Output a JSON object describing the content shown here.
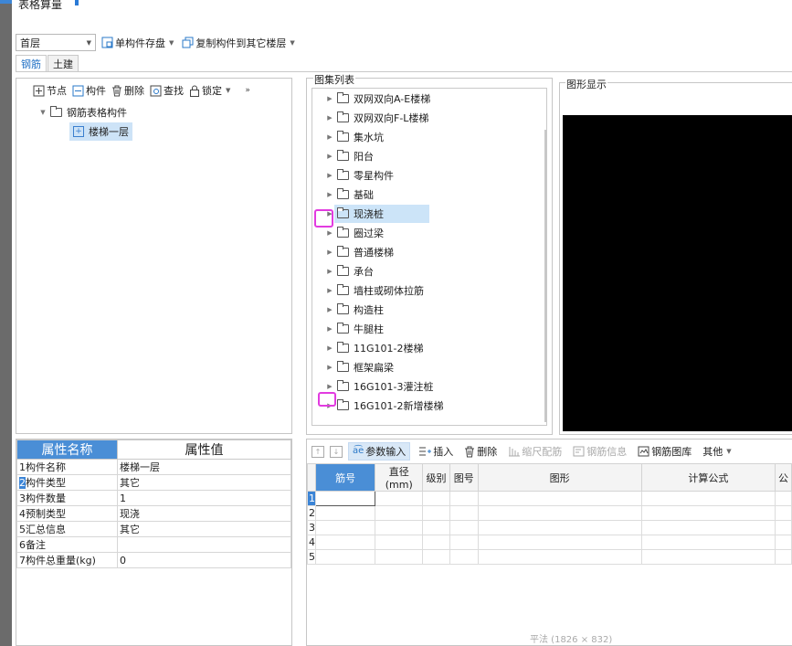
{
  "window": {
    "title": "表格算量"
  },
  "toolbar": {
    "floor_value": "首层",
    "save_single_label": "单构件存盘",
    "copy_to_floor_label": "复制构件到其它楼层"
  },
  "tabs": [
    "钢筋",
    "土建"
  ],
  "left_toolbar": {
    "node": "节点",
    "component": "构件",
    "delete": "删除",
    "find": "查找",
    "lock": "锁定"
  },
  "left_tree": {
    "root": "钢筋表格构件",
    "child": "楼梯一层"
  },
  "gallery": {
    "title": "图集列表",
    "items": [
      "双网双向A-E楼梯",
      "双网双向F-L楼梯",
      "集水坑",
      "阳台",
      "零星构件",
      "基础",
      "现浇桩",
      "圈过梁",
      "普通楼梯",
      "承台",
      "墙柱或砌体拉筋",
      "构造柱",
      "牛腿柱",
      "11G101-2楼梯",
      "框架扁梁",
      "16G101-3灌注桩",
      "16G101-2新增楼梯"
    ],
    "selected_index": 6
  },
  "display": {
    "title": "图形显示"
  },
  "properties": {
    "header_name": "属性名称",
    "header_value": "属性值",
    "rows": [
      {
        "num": "1",
        "name": "构件名称",
        "value": "楼梯一层"
      },
      {
        "num": "2",
        "name": "构件类型",
        "value": "其它"
      },
      {
        "num": "3",
        "name": "构件数量",
        "value": "1"
      },
      {
        "num": "4",
        "name": "预制类型",
        "value": "现浇"
      },
      {
        "num": "5",
        "name": "汇总信息",
        "value": "其它"
      },
      {
        "num": "6",
        "name": "备注",
        "value": ""
      },
      {
        "num": "7",
        "name": "构件总重量(kg)",
        "value": "0"
      }
    ]
  },
  "rebar_toolbar": {
    "param_input": "参数输入",
    "insert": "插入",
    "delete": "删除",
    "scale_rebar": "缩尺配筋",
    "rebar_info": "钢筋信息",
    "rebar_library": "钢筋图库",
    "other": "其他"
  },
  "rebar_table": {
    "headers": [
      "筋号",
      "直径(mm)",
      "级别",
      "图号",
      "图形",
      "计算公式",
      "公"
    ],
    "row_numbers": [
      "1",
      "2",
      "3",
      "4",
      "5"
    ]
  },
  "status": {
    "text": "平法 (1826 × 832)"
  }
}
